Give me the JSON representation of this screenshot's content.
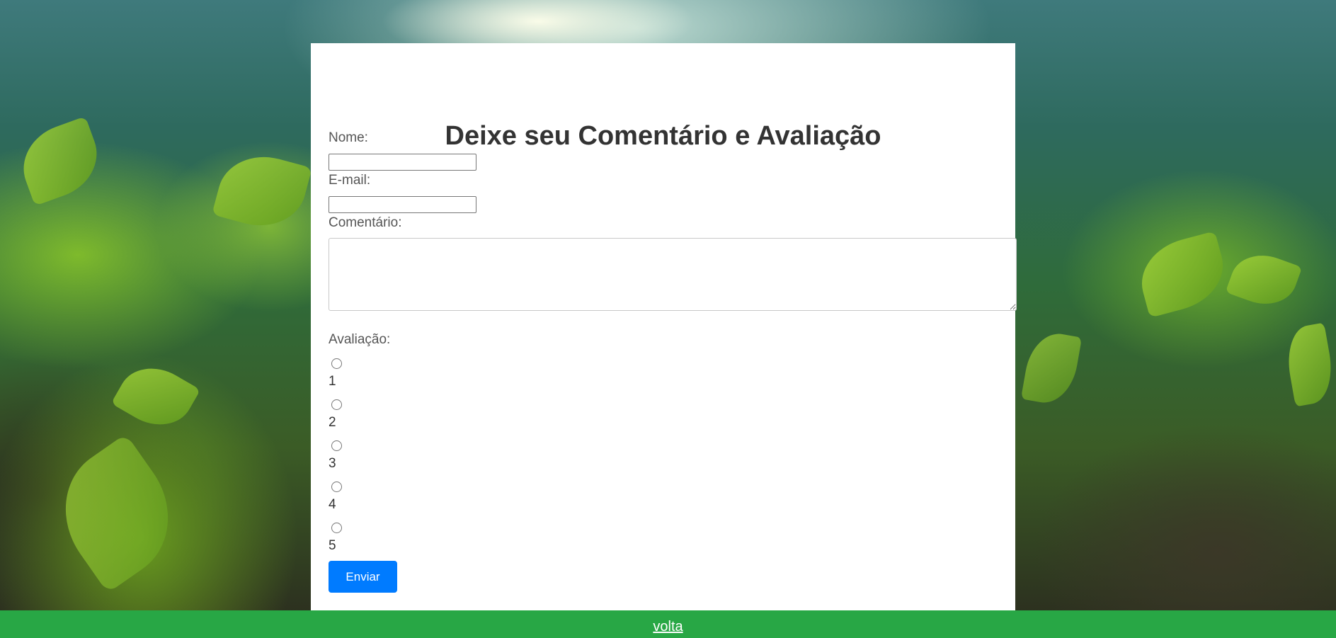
{
  "form": {
    "title": "Deixe seu Comentário e Avaliação",
    "name_label": "Nome:",
    "name_value": "",
    "email_label": "E-mail:",
    "email_value": "",
    "comment_label": "Comentário:",
    "comment_value": "",
    "rating_label": "Avaliação:",
    "rating_options": [
      "1",
      "2",
      "3",
      "4",
      "5"
    ],
    "submit_label": "Enviar"
  },
  "footer": {
    "link_label": "volta"
  },
  "colors": {
    "submit_button": "#007bff",
    "footer_bar": "#28a745",
    "card": "#ffffff"
  }
}
